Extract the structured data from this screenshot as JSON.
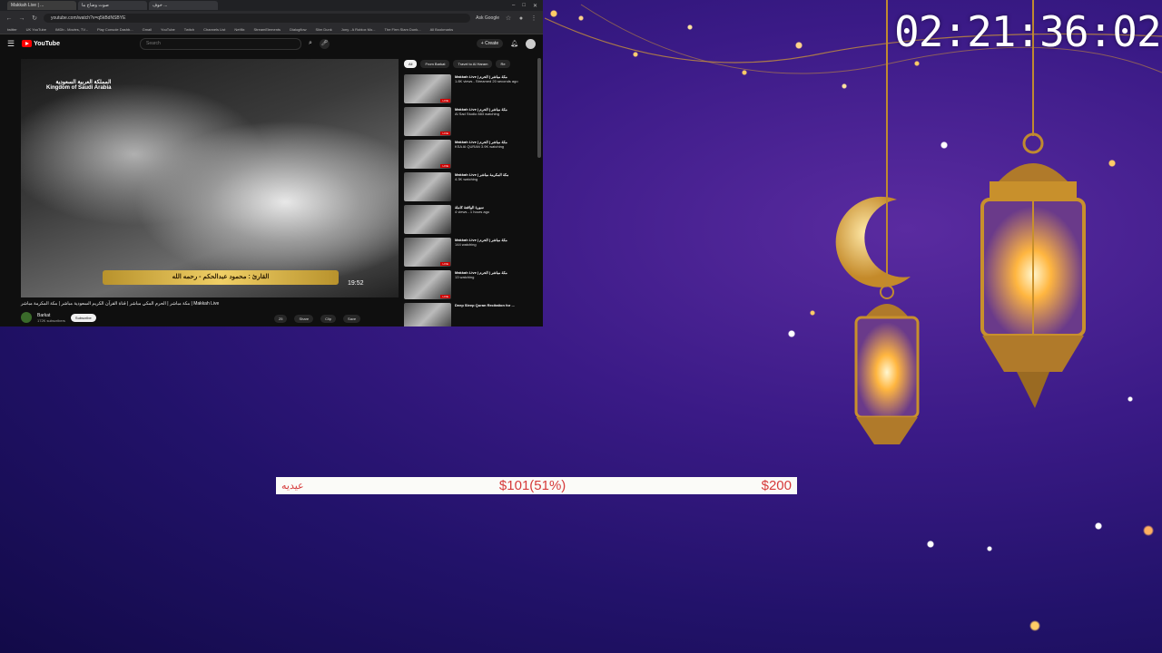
{
  "browser": {
    "tabs": [
      "Makkah Live | ...",
      "صوت وضاح ما",
      "خوف ..."
    ],
    "address": "youtube.com/watch?v=q5kBdNSBYE",
    "ask_google": "Ask Google",
    "bookmarks": [
      "twitter",
      "UK YouTube",
      "IMDb - Movies, TV...",
      "Play Console Dashb...",
      "Gmail",
      "YouTube",
      "Twitch",
      "Channels List",
      "Netflix",
      "StreamElements",
      "Dialogflow",
      "Slim Dunk",
      "Jony - A Roblox Mo...",
      "The Firm Slam Dunk...",
      "All Bookmarks"
    ]
  },
  "youtube": {
    "search_placeholder": "Search",
    "create_label": "Create",
    "player_overlay_ksa": "المملكة العربية السعودية\nKingdom of Saudi Arabia",
    "player_banner": "القارئ : محمود عبدالحكم - رحمه الله",
    "player_time": "19:52",
    "video_title": "مكة مباشر | الحرم المكي مباشر | قناة القرآن الكريم السعودية مباشر | مكة المكرمة مباشر | Makkah Live",
    "channel_name": "Barkat",
    "channel_subs": "172K subscribers",
    "subscribe_label": "Subscribe",
    "actions": [
      "25",
      "Share",
      "Clip",
      "Save"
    ],
    "chips": [
      "All",
      "From Barkat",
      "Travel to Al Haram",
      "Re"
    ],
    "related": [
      {
        "title": "Makkah Live | مكة مباشر | الحرم",
        "meta": "1.8K views - Streamed 20 seconds ago"
      },
      {
        "title": "Makkah Live | مكة مباشر | الحرم",
        "meta": "Al Sad Studio\n883 watching"
      },
      {
        "title": "Makkah Live | مكة مباشر | الحرم",
        "meta": "KSA Al QURAN\n3.9K watching"
      },
      {
        "title": "Makkah Live | مكة المكرمة مباشر",
        "meta": "4.3K watching"
      },
      {
        "title": "سورة الواقعة كاملة",
        "meta": "4 views - 1 hours ago"
      },
      {
        "title": "Makkah Live | مكة مباشر | الحرم",
        "meta": "144 watching"
      },
      {
        "title": "Makkah Live | مكة مباشر | الحرم",
        "meta": "13 watching"
      },
      {
        "title": "Deep Sleep Quran Recitation for ...",
        "meta": ""
      }
    ]
  },
  "overlay": {
    "clock": "02:21:36:02",
    "goal": {
      "label": "عيديه",
      "current": "$101(51%)",
      "target": "$200",
      "progress_percent": 51
    }
  }
}
